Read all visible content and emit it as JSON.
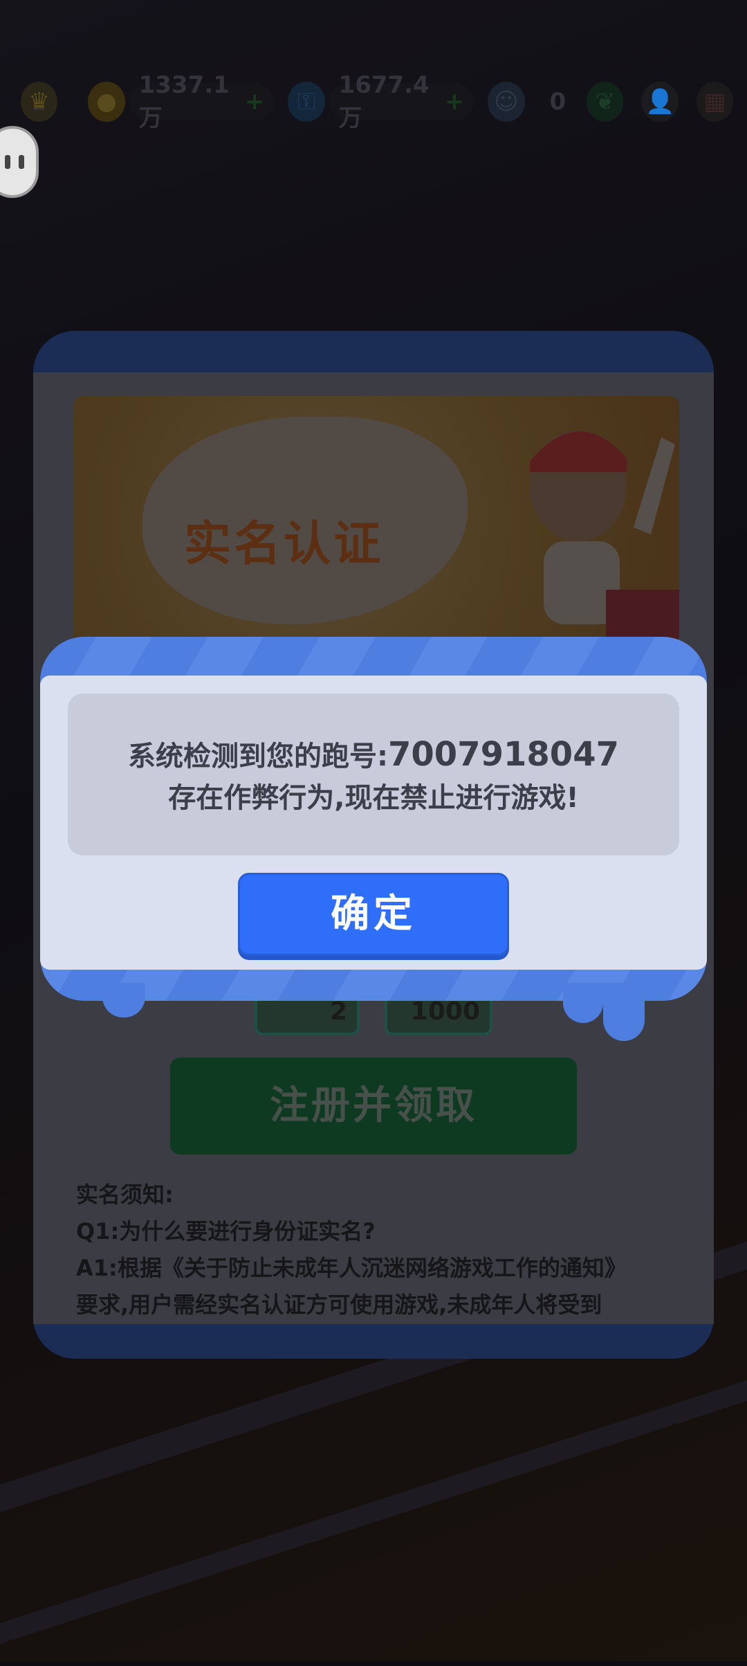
{
  "hud": {
    "coins": "1337.1万",
    "keys": "1677.4万",
    "score": "0"
  },
  "realname_panel": {
    "banner_title": "实名认证",
    "reward_count_1": "2",
    "reward_count_2": "1000",
    "register_button": "注册并领取",
    "notes": [
      "实名须知:",
      "Q1:为什么要进行身份证实名?",
      "A1:根据《关于防止未成年人沉迷网络游戏工作的通知》",
      "要求,用户需经实名认证方可使用游戏,未成年人将受到"
    ]
  },
  "alert": {
    "message_prefix": "系统检测到您的跑号:",
    "account_id": "7007918047",
    "message_line2": "存在作弊行为,现在禁止进行游戏!",
    "confirm_button": "确定"
  },
  "colors": {
    "alert_frame": "#4e7ee0",
    "confirm_button": "#2f6ef8",
    "alert_body": "#dbe0f0"
  },
  "icons": [
    "crown-icon",
    "coin-icon",
    "key-icon",
    "score-icon",
    "friends-icon",
    "gift-icon",
    "pause-icon"
  ]
}
